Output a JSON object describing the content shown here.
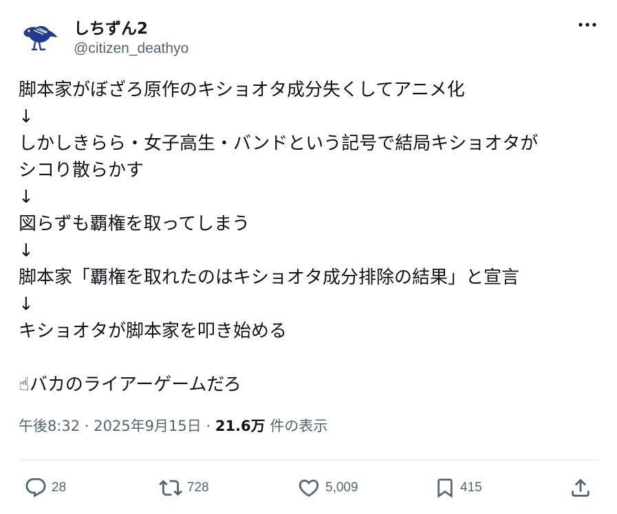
{
  "author": {
    "display_name": "しちずん2",
    "handle": "@citizen_deathyo"
  },
  "tweet": {
    "lines": [
      "脚本家がぼざろ原作のキショオタ成分失くしてアニメ化",
      "↓",
      "しかしきらら・女子高生・バンドという記号で結局キショオタが",
      "シコり散らかす",
      "↓",
      "図らずも覇権を取ってしまう",
      "↓",
      "脚本家「覇権を取れたのはキショオタ成分排除の結果」と宣言",
      "↓",
      "キショオタが脚本家を叩き始める",
      "",
      "☝バカのライアーゲームだろ"
    ]
  },
  "meta": {
    "time": "午後8:32",
    "separator": "·",
    "date": "2025年9月15日",
    "views": "21.6万",
    "views_label": "件の表示"
  },
  "actions": {
    "replies": "28",
    "reposts": "728",
    "likes": "5,009",
    "bookmarks": "415"
  },
  "icons": {
    "more": "more-horizontal-icon",
    "reply": "reply-icon",
    "repost": "repost-icon",
    "like": "heart-icon",
    "bookmark": "bookmark-icon",
    "share": "share-icon"
  },
  "colors": {
    "text": "#0f1419",
    "secondary": "#536471",
    "avatar_bird": "#1f3c8f"
  }
}
